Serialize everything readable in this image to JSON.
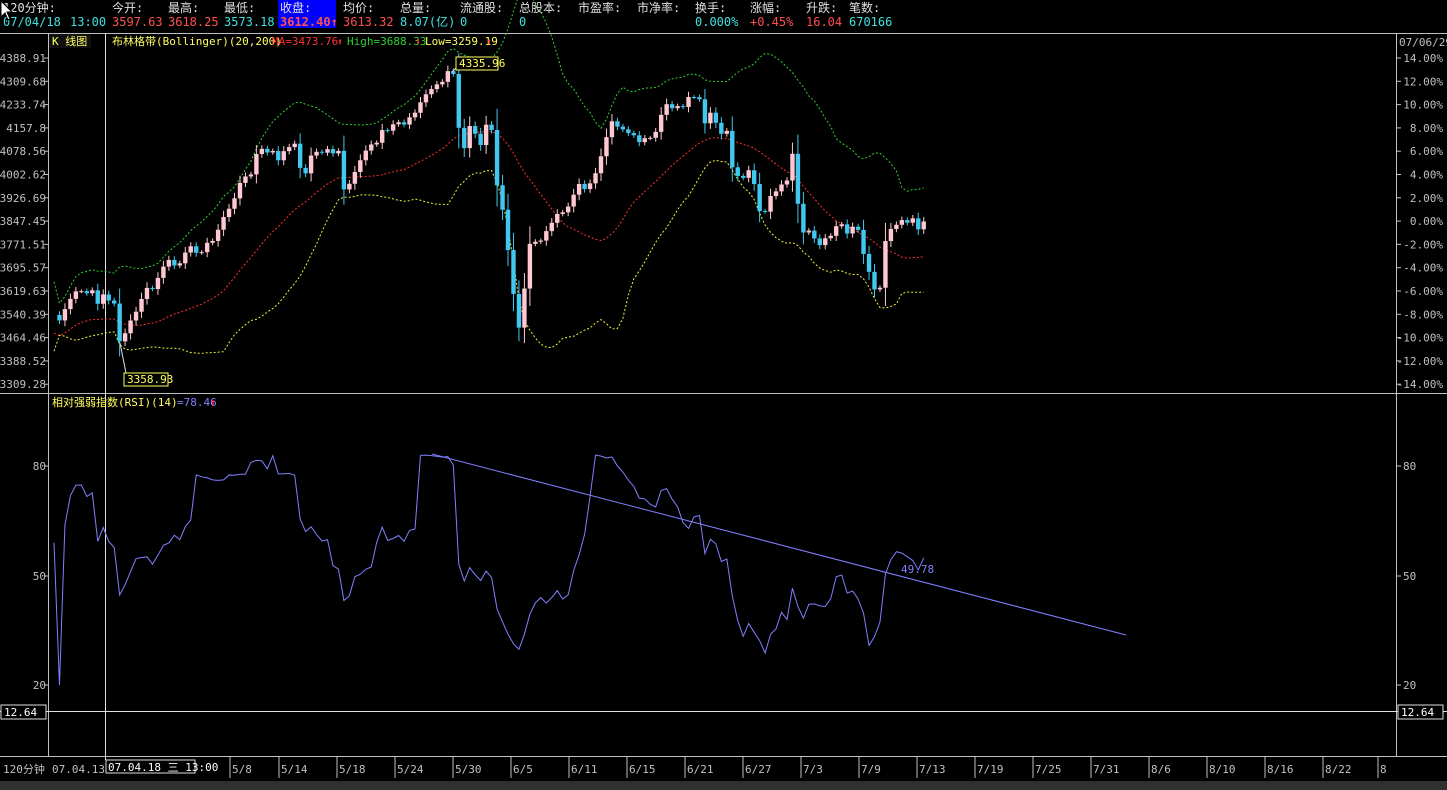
{
  "header": {
    "labels": [
      "120分钟:",
      "今开:",
      "最高:",
      "最低:",
      "收盘:",
      "均价:",
      "总量:",
      "流通股:",
      "总股本:",
      "市盈率:",
      "市净率:",
      "换手:",
      "涨幅:",
      "升跌:",
      "笔数:"
    ],
    "values": [
      "07/04/18",
      "13:00",
      "3597.63",
      "3618.25",
      "3573.18",
      "3612.40↑",
      "3613.32",
      "8.07(亿)",
      "0",
      "0",
      "",
      "",
      "0.000%",
      "+0.45%",
      "16.04",
      "670166"
    ]
  },
  "main_panel": {
    "title": "K 线图",
    "indicator_name": "布林格带(Bollinger)(20,200)",
    "ma_text": "MA=3473.76",
    "high_text": "High=3688.33",
    "low_text": "Low=3259.19",
    "right_top_date": "07/06/29",
    "y_labels": [
      "4388.91",
      "4309.68",
      "4233.74",
      "4157.8",
      "4078.56",
      "4002.62",
      "3926.69",
      "3847.45",
      "3771.51",
      "3695.57",
      "3619.63",
      "3540.39",
      "3464.46",
      "3388.52",
      "3309.28"
    ],
    "pct_labels": [
      "14.00%",
      "12.00%",
      "10.00%",
      "8.00%",
      "6.00%",
      "4.00%",
      "2.00%",
      "0.00%",
      "-2.00%",
      "-4.00%",
      "-6.00%",
      "-8.00%",
      "-10.00%",
      "-12.00%",
      "-14.00%"
    ],
    "max_marker": "4335.96",
    "min_marker": "3358.93"
  },
  "rsi_panel": {
    "title": "相对强弱指数(RSI)(14)",
    "value_text": "=78.46",
    "y_labels": [
      "80",
      "50",
      "20"
    ],
    "trend_value": "49.78",
    "cursor_value": "12.64"
  },
  "x_axis": {
    "left_label": "120分钟",
    "start_label": "07.04.13",
    "cursor_label": "07.04.18 三 13:00",
    "dates": [
      "5/8",
      "5/14",
      "5/18",
      "5/24",
      "5/30",
      "6/5",
      "6/11",
      "6/15",
      "6/21",
      "6/27",
      "7/3",
      "7/9",
      "7/13",
      "7/19",
      "7/25",
      "7/31",
      "8/6",
      "8/10",
      "8/16",
      "8/22",
      "8"
    ]
  },
  "colors": {
    "up_candle": "#ffc8d2",
    "down_candle": "#40c8f0",
    "ma": "#ff3030",
    "upper": "#30d030",
    "lower": "#f0f040",
    "rsi": "#8080ff",
    "axis": "#c0c0c0",
    "label_yellow": "#ffff60",
    "header_cyan": "#40e0e0",
    "header_red": "#ff5050",
    "header_blue_bg": "#0000ff"
  },
  "chart_data": {
    "type": "candlestick",
    "price_series": [
      3537.9,
      3519.82,
      3557.39,
      3591.22,
      3616.09,
      3616.75,
      3609.77,
      3619.63,
      3574.97,
      3605.86,
      3585.81,
      3575.7,
      3450.45,
      3477.41,
      3519.59,
      3548.6,
      3590.93,
      3627.45,
      3623.68,
      3660.68,
      3698.13,
      3720.08,
      3701.65,
      3708.89,
      3744.58,
      3765.38,
      3744.01,
      3745.93,
      3776.73,
      3782.96,
      3820.26,
      3862.16,
      3889.73,
      3924.24,
      3975.25,
      3996.57,
      4003.42,
      4070.99,
      4088.19,
      4076.06,
      4080.94,
      4050.2,
      4080.38,
      4093.9,
      4105.12,
      4025.04,
      4006.93,
      4065.81,
      4078.41,
      4075.22,
      4087.11,
      4072.92,
      4081.26,
      3953.65,
      3972.36,
      4011.33,
      4050.24,
      4082.33,
      4102.57,
      4108.24,
      4150.17,
      4148.12,
      4169.33,
      4176.25,
      4168.49,
      4192.45,
      4207.61,
      4242.02,
      4268.74,
      4286.01,
      4301.46,
      4309.94,
      4345.4,
      4335.96,
      4157.72,
      4090.55,
      4163.68,
      4138.19,
      4100.7,
      4168.02,
      4150.52,
      3967.51,
      3886.55,
      3752.95,
      3607.51,
      3496.02,
      3625.47,
      3773.47,
      3780.36,
      3784.33,
      3815.57,
      3843.2,
      3872.31,
      3877.78,
      3897.14,
      3936.17,
      3971.68,
      3954.95,
      3973.76,
      4007.34,
      4063.48,
      4126.85,
      4179.29,
      4161.67,
      4152.69,
      4140.31,
      4132.9,
      4110.27,
      4123.17,
      4124.53,
      4144.25,
      4200.6,
      4235.94,
      4222.58,
      4229.63,
      4226.7,
      4259.62,
      4259.18,
      4252.16,
      4172.56,
      4207.81,
      4174.33,
      4137.86,
      4147.5,
      4026.96,
      3998.26,
      3992.02,
      4017.29,
      3971.52,
      3882.04,
      3879.84,
      3931.86,
      3947.14,
      3970.04,
      3983.16,
      4071.7,
      3906.21,
      3811.06,
      3817.37,
      3791.35,
      3769.3,
      3791.99,
      3800.08,
      3831.92,
      3838.04,
      3807.56,
      3830.18,
      3819.57,
      3740.08,
      3680.75,
      3622.36,
      3628.11,
      3782.77,
      3822.81,
      3836.56,
      3852.14,
      3843.54,
      3857.94,
      3821.47,
      3847.45
    ],
    "ma_series": [
      3460,
      3612.4
    ],
    "bands": {
      "upper": "green dotted",
      "lower": "yellow dotted"
    },
    "rsi_trendline": {
      "start_value": 83,
      "end_value": 49.78
    },
    "ylim": [
      3309.28,
      4388.91
    ],
    "rsi_ylim": [
      12.64,
      100
    ]
  }
}
